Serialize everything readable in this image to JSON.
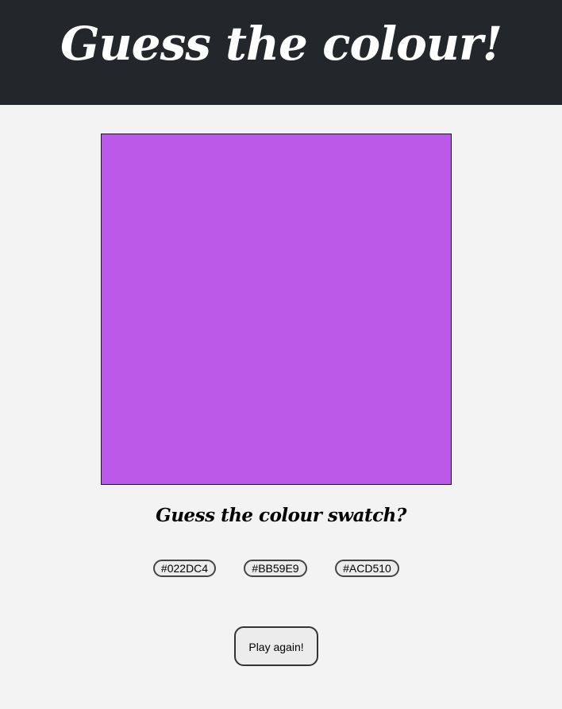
{
  "header": {
    "title": "Guess the colour!",
    "background": "#23262b"
  },
  "swatch": {
    "color": "#BB59E9"
  },
  "question": "Guess the colour swatch?",
  "options": [
    {
      "label": "#022DC4"
    },
    {
      "label": "#BB59E9"
    },
    {
      "label": "#ACD510"
    }
  ],
  "play_again_label": "Play again!"
}
